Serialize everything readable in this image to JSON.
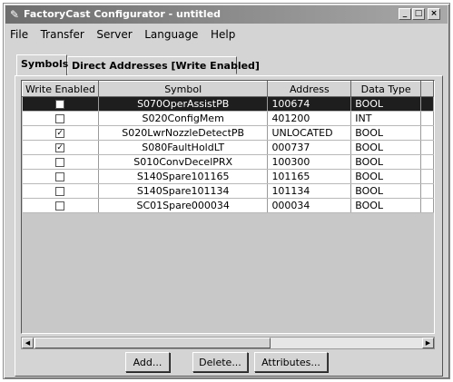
{
  "window": {
    "title": "FactoryCast Configurator - untitled",
    "controls": {
      "minimize": "_",
      "maximize": "□",
      "close": "×"
    }
  },
  "menu": [
    "File",
    "Transfer",
    "Server",
    "Language",
    "Help"
  ],
  "tabs": [
    {
      "label": "Symbols",
      "active": true
    },
    {
      "label": "Direct Addresses [Write Enabled]",
      "active": false
    }
  ],
  "table": {
    "columns": [
      "Write Enabled",
      "Symbol",
      "Address",
      "Data Type"
    ],
    "rows": [
      {
        "write_enabled": false,
        "symbol": "S070OperAssistPB",
        "address": "100674",
        "data_type": "BOOL",
        "selected": true
      },
      {
        "write_enabled": false,
        "symbol": "S020ConfigMem",
        "address": "401200",
        "data_type": "INT",
        "selected": false
      },
      {
        "write_enabled": true,
        "symbol": "S020LwrNozzleDetectPB",
        "address": "UNLOCATED",
        "data_type": "BOOL",
        "selected": false
      },
      {
        "write_enabled": true,
        "symbol": "S080FaultHoldLT",
        "address": "000737",
        "data_type": "BOOL",
        "selected": false
      },
      {
        "write_enabled": false,
        "symbol": "S010ConvDecelPRX",
        "address": "100300",
        "data_type": "BOOL",
        "selected": false
      },
      {
        "write_enabled": false,
        "symbol": "S140Spare101165",
        "address": "101165",
        "data_type": "BOOL",
        "selected": false
      },
      {
        "write_enabled": false,
        "symbol": "S140Spare101134",
        "address": "101134",
        "data_type": "BOOL",
        "selected": false
      },
      {
        "write_enabled": false,
        "symbol": "SC01Spare000034",
        "address": "000034",
        "data_type": "BOOL",
        "selected": false
      }
    ]
  },
  "buttons": {
    "add": "Add...",
    "delete": "Delete...",
    "attributes": "Attributes..."
  },
  "icons": {
    "app": "factorycast-app-icon",
    "scroll_left": "arrow-left-icon",
    "scroll_right": "arrow-right-icon"
  },
  "colors": {
    "selection": "#1e1e1e",
    "window_bg": "#d4d4d4",
    "table_bg": "#c8c8c8"
  }
}
